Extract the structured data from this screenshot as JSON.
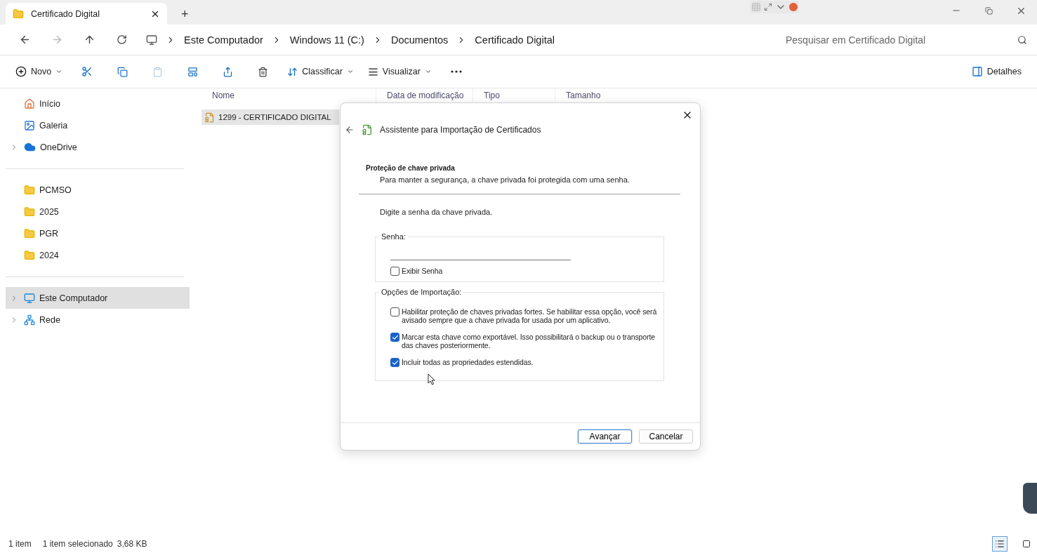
{
  "window": {
    "tab_title": "Certificado Digital",
    "new_tab": "+"
  },
  "address_bar": {
    "breadcrumbs": [
      "Este Computador",
      "Windows 11 (C:)",
      "Documentos",
      "Certificado Digital"
    ],
    "search": {
      "placeholder": "Pesquisar em Certificado Digital"
    }
  },
  "command_bar": {
    "new": "Novo",
    "sort": "Classificar",
    "view": "Visualizar",
    "details": "Detalhes"
  },
  "sidebar": {
    "places": [
      {
        "label": "Início",
        "expandable": false,
        "selected": false
      },
      {
        "label": "Galeria",
        "expandable": false,
        "selected": false
      },
      {
        "label": "OneDrive",
        "expandable": true,
        "selected": false
      }
    ],
    "pinned": [
      {
        "label": "PCMSO",
        "selected": false
      },
      {
        "label": "2025",
        "selected": false
      },
      {
        "label": "PGR",
        "selected": false
      },
      {
        "label": "2024",
        "selected": false
      }
    ],
    "devices": [
      {
        "label": "Este Computador",
        "expandable": true,
        "selected": true
      },
      {
        "label": "Rede",
        "expandable": true,
        "selected": false
      }
    ]
  },
  "file_list": {
    "columns": [
      "Nome",
      "Data de modificação",
      "Tipo",
      "Tamanho"
    ],
    "rows": [
      {
        "name": "1299 - CERTIFICADO DIGITAL",
        "selected": true
      }
    ]
  },
  "dialog": {
    "title": "Assistente para Importação de Certificados",
    "heading": "Proteção de chave privada",
    "subheading": "Para manter a segurança, a chave privada foi protegida com uma senha.",
    "prompt": "Digite a senha da chave privada.",
    "password_group": {
      "legend": "Senha:",
      "show_password": {
        "label": "Exibir Senha",
        "checked": false
      }
    },
    "import_options": {
      "legend": "Opções de Importação:",
      "items": [
        {
          "label": "Habilitar proteção de chaves privadas fortes. Se habilitar essa opção, você será avisado sempre que a chave privada for usada por um aplicativo.",
          "checked": false
        },
        {
          "label": "Marcar esta chave como exportável. Isso possibilitará o backup ou o transporte das chaves posteriormente.",
          "checked": true
        },
        {
          "label": "Incluir todas as propriedades estendidas.",
          "checked": true
        }
      ]
    },
    "buttons": [
      {
        "label": "Avançar",
        "focused": true
      },
      {
        "label": "Cancelar",
        "focused": false
      }
    ]
  },
  "status_bar": {
    "count": "1 item",
    "selection": "1 item selecionado",
    "size": "3,68 KB"
  }
}
